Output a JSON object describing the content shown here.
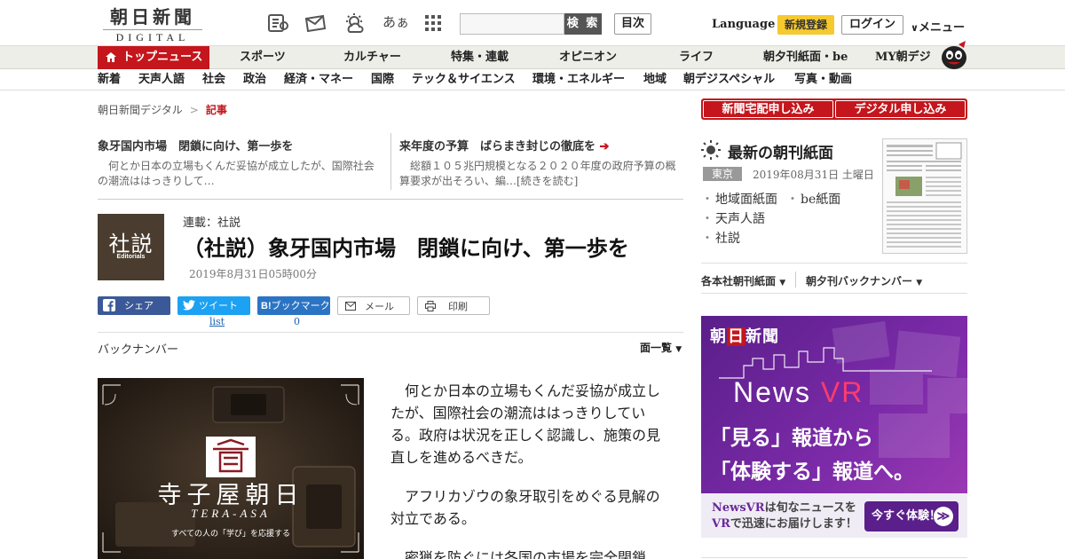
{
  "header": {
    "logo_jp": "朝日新聞",
    "logo_en": "DIGITAL",
    "font_size_label": "あぁ",
    "search_placeholder": "",
    "search_button": "検 索",
    "contents_button": "目次",
    "language": "Language",
    "register": "新規登録",
    "login": "ログイン",
    "menu": "メニュー",
    "icons": [
      "newspaper-icon",
      "mail-icon",
      "weather-icon",
      "font-size-icon",
      "grid-menu-icon"
    ]
  },
  "nav_main": [
    {
      "label": "トップニュース",
      "active": true
    },
    {
      "label": "スポーツ"
    },
    {
      "label": "カルチャー"
    },
    {
      "label": "特集・連載"
    },
    {
      "label": "オピニオン"
    },
    {
      "label": "ライフ"
    },
    {
      "label": "朝夕刊紙面・be"
    },
    {
      "label": "MY朝デジ"
    }
  ],
  "nav_sub": [
    "新着",
    "天声人語",
    "社会",
    "政治",
    "経済・マネー",
    "国際",
    "テック＆サイエンス",
    "環境・エネルギー",
    "地域",
    "朝デジスペシャル",
    "写真・動画"
  ],
  "breadcrumb": {
    "home": "朝日新聞デジタル",
    "sep": ">",
    "current": "記事"
  },
  "related": [
    {
      "title": "象牙国内市場　閉鎖に向け、第一歩を",
      "body": "何とか日本の立場もくんだ妥協が成立したが、国際社会の潮流ははっきりして…"
    },
    {
      "title": "来年度の予算　ばらまき封じの徹底を",
      "arrow": "➔",
      "body": "総額１０５兆円規模となる２０２０年度の政府予算の概算要求が出そろい、編…[続きを読む]"
    }
  ],
  "article": {
    "thumb_kanji": "社説",
    "thumb_en": "Editorials",
    "series": "連載：社説",
    "headline": "（社説）象牙国内市場　閉鎖に向け、第一歩を",
    "date": "2019年8月31日05時00分",
    "share": {
      "facebook": "シェア",
      "twitter": "ツイート",
      "hatena": "ブックマーク",
      "hatena_mark": "B!",
      "mail": "メール",
      "print": "印刷",
      "twitter_count": "list",
      "hatena_count": "0"
    },
    "backnumber": "バックナンバー",
    "list_label": "面一覧",
    "paragraphs": [
      "何とか日本の立場もくんだ妥協が成立したが、国際社会の潮流ははっきりしている。政府は状況を正しく認識し、施策の見直しを進めるべきだ。",
      "アフリカゾウの象牙取引をめぐる見解の対立である。",
      "密猟を防ぐには各国の市場を完全閉鎖"
    ]
  },
  "promo": {
    "brand": "寺子屋朝日",
    "brand_en": "TERA-ASA",
    "tagline": "すべての人の「学び」を応援する"
  },
  "sidebar": {
    "apply_delivery": "新聞宅配申し込み",
    "apply_digital": "デジタル申し込み",
    "paper_title": "最新の朝刊紙面",
    "region": "東京",
    "paper_date": "2019年08月31日 土曜日",
    "paper_links": [
      "地域面紙面",
      "be紙面",
      "天声人語",
      "社説"
    ],
    "dd_morning": "各本社朝刊紙面",
    "dd_backnumber": "朝夕刊バックナンバー"
  },
  "ad": {
    "brand_a": "朝",
    "brand_b": "日",
    "brand_c": "新聞",
    "news": "News ",
    "vr": "VR",
    "line1": "「見る」報道から",
    "line2": "「体験する」報道へ。",
    "foot1": "NewsVR",
    "foot1b": "は旬なニュースを",
    "foot2": "VR",
    "foot2b": "で迅速にお届けします！",
    "cta": "今すぐ体験！",
    "cta_arrow": "≫"
  },
  "colors": {
    "brand_red": "#c4161c",
    "register_yellow": "#f6c92e",
    "vr_purple": "#5a1f8a"
  }
}
